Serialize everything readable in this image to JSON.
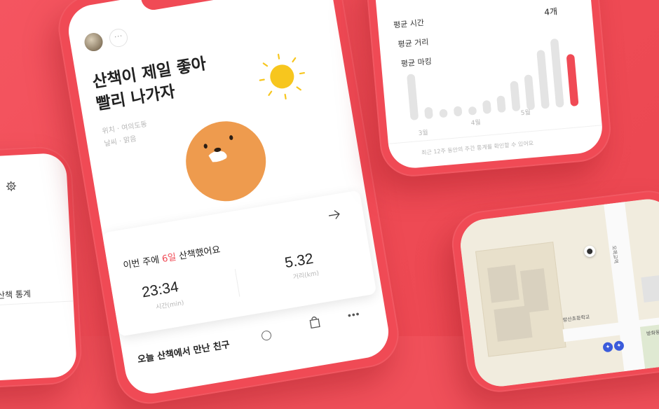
{
  "left_phone": {
    "stats_label": "산책 통계"
  },
  "main_phone": {
    "title_line1": "산책이 제일 좋아",
    "title_line2": "빨리 나가자",
    "location": "위치 · 여의도동",
    "weather": "날씨 · 맑음",
    "card": {
      "heading_prefix": "이번 주에 ",
      "heading_days": "6일",
      "heading_suffix": " 산책했어요",
      "time_value": "23:34",
      "time_label": "시간(min)",
      "distance_value": "5.32",
      "distance_label": "거리(km)"
    },
    "next_section": "오늘 산책에서 만난 친구"
  },
  "stats_phone": {
    "rows": [
      {
        "label": "평균 시간",
        "value": "4개"
      },
      {
        "label": "평균 거리",
        "value": ""
      },
      {
        "label": "평균 마킹",
        "value": ""
      }
    ],
    "x_labels": [
      "3월",
      "4월",
      "5월"
    ],
    "bar_heights": [
      0.55,
      0.14,
      0.1,
      0.12,
      0.1,
      0.16,
      0.2,
      0.36,
      0.42,
      0.7,
      0.82,
      0.62
    ],
    "highlight_index": 11,
    "footnote": "최근 12주 동안의 주간 통계를 확인할 수 있어요"
  },
  "map_phone": {
    "school_label": "방산초등학교",
    "road_label": "오목교역",
    "place_label": "방화동대전유초교"
  },
  "colors": {
    "accent": "#f04a55",
    "sun": "#f7c61e",
    "dog": "#ee9b4e",
    "bar_grey": "#e4e4e4"
  }
}
